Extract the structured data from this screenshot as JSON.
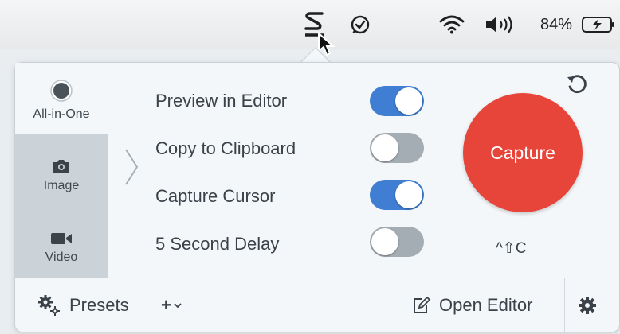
{
  "menubar": {
    "app_icon": "snagit-s-icon",
    "status_icon": "check-speech-bubble-icon",
    "wifi_icon": "wifi-icon",
    "volume_icon": "volume-icon",
    "battery_percent": "84%",
    "battery_icon": "battery-charging-icon"
  },
  "modes": [
    {
      "label": "All-in-One",
      "icon": "all-in-one-icon",
      "selected": true
    },
    {
      "label": "Image",
      "icon": "camera-icon",
      "selected": false
    },
    {
      "label": "Video",
      "icon": "video-camera-icon",
      "selected": false
    }
  ],
  "options": [
    {
      "label": "Preview in Editor",
      "on": true
    },
    {
      "label": "Copy to Clipboard",
      "on": false
    },
    {
      "label": "Capture Cursor",
      "on": true
    },
    {
      "label": "5 Second Delay",
      "on": false
    }
  ],
  "capture": {
    "label": "Capture",
    "shortcut": "^⇧C",
    "color": "#e8453a"
  },
  "footer": {
    "presets_label": "Presets",
    "add_label": "+",
    "open_editor_label": "Open Editor"
  },
  "colors": {
    "toggle_on": "#3f7ed3",
    "toggle_off": "#a5adb4",
    "sidebar_strip": "#cbd3d9"
  }
}
